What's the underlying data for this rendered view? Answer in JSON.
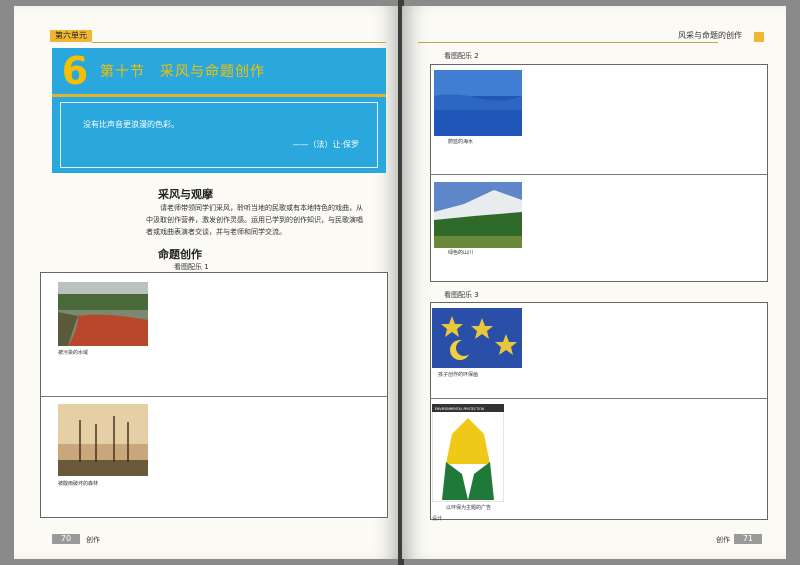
{
  "left_page": {
    "unit_tab": "第六单元",
    "chapter_number": "6",
    "chapter_title": "第十节　采风与命题创作",
    "quote": {
      "text": "没有比声音更浪漫的色彩。",
      "author": "——（法）让·保罗"
    },
    "section1": {
      "heading": "采风与观摩",
      "lines": [
        "请老师带领同学们采风，聆听当地的民歌或有本地特色的戏曲，从",
        "中汲取创作营养，激发创作灵感。运用已学到的创作知识，与民歌演唱",
        "者或戏曲表演者交谈，并与老师和同学交流。"
      ]
    },
    "section2": {
      "heading": "命题创作",
      "sub_label": "看图配乐 1"
    },
    "captions": [
      "被污染的水域",
      "被酸雨破坏的森林"
    ],
    "page_number": "70",
    "footer_word": "创作"
  },
  "right_page": {
    "header_title": "风采与命题的创作",
    "label2": "看图配乐 2",
    "label3": "看图配乐 3",
    "captions": [
      "蔚蓝的海水",
      "绿色的山川",
      "孩子创作的环保画",
      "以环保为主题的广告",
      "设计"
    ],
    "poster_text": "ENVIRONMENTAL PROTECTION",
    "page_number": "71",
    "footer_word": "创作"
  },
  "colors": {
    "banner_blue": "#2aa8dd",
    "accent_yellow": "#f0b733"
  }
}
